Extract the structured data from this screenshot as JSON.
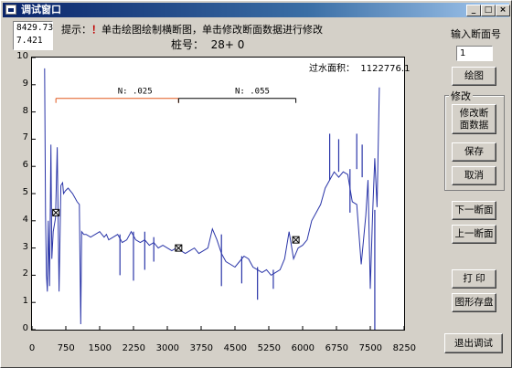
{
  "window": {
    "title": "调试窗口",
    "controls": {
      "minimize": "_",
      "maximize": "□",
      "close": "×"
    }
  },
  "coords": {
    "x": "8429.73",
    "y": "7.421"
  },
  "hint": {
    "prefix": "提示：",
    "mark": "！",
    "text": "单击绘图绘制横断图，单击修改断面数据进行修改"
  },
  "station": {
    "label": "桩号：",
    "value": "28+ 0"
  },
  "area": {
    "label": "过水面积：",
    "value": "1122776.1"
  },
  "roughness": [
    {
      "label": "N: .025",
      "color": "#e0581f"
    },
    {
      "label": "N: .055",
      "color": "#000000"
    }
  ],
  "sidebar": {
    "section_input_label": "输入断面号",
    "section_input_value": "1",
    "draw_button": "绘图",
    "modify_group_title": "修改",
    "modify_button": "修改断面数据",
    "save_button": "保存",
    "cancel_button": "取消",
    "next_button": "下一断面",
    "prev_button": "上一断面",
    "print_button": "打 印",
    "save_image_button": "图形存盘",
    "exit_button": "退出调试"
  },
  "chart_data": {
    "type": "line",
    "title": "",
    "xlabel": "",
    "ylabel": "",
    "xlim": [
      0,
      8250
    ],
    "ylim": [
      0,
      10
    ],
    "x_ticks": [
      "0",
      "750",
      "1500",
      "2250",
      "3000",
      "3750",
      "4500",
      "5250",
      "6000",
      "6750",
      "7500",
      "8250"
    ],
    "y_ticks": [
      "0",
      "1",
      "2",
      "3",
      "4",
      "5",
      "6",
      "7",
      "8",
      "9",
      "10"
    ],
    "grid": false,
    "series": [
      {
        "color": "#2a35a8",
        "x": [
          280,
          300,
          320,
          340,
          360,
          390,
          420,
          440,
          470,
          520,
          560,
          600,
          640,
          680,
          700,
          740,
          800,
          900,
          1000,
          1050,
          1080,
          1100,
          1150,
          1200,
          1300,
          1400,
          1500,
          1600,
          1650,
          1700,
          1800,
          1900,
          2000,
          2100,
          2200,
          2300,
          2400,
          2500,
          2600,
          2700,
          2800,
          2900,
          3000,
          3100,
          3200,
          3300,
          3400,
          3500,
          3600,
          3700,
          3800,
          3900,
          4000,
          4100,
          4200,
          4300,
          4400,
          4500,
          4600,
          4700,
          4800,
          4900,
          5000,
          5100,
          5200,
          5300,
          5400,
          5500,
          5600,
          5700,
          5800,
          5900,
          6000,
          6100,
          6200,
          6300,
          6400,
          6500,
          6600,
          6700,
          6800,
          6900,
          7000,
          7100,
          7200,
          7300,
          7400,
          7450,
          7500,
          7550,
          7600,
          7650,
          7700
        ],
        "y": [
          9.6,
          4.2,
          2.0,
          1.4,
          4.0,
          1.6,
          6.8,
          2.6,
          3.6,
          4.1,
          6.7,
          1.4,
          5.3,
          5.4,
          5.0,
          5.1,
          5.2,
          5.0,
          4.7,
          4.6,
          0.2,
          3.6,
          3.5,
          3.5,
          3.4,
          3.5,
          3.6,
          3.4,
          3.5,
          3.3,
          3.4,
          3.5,
          3.2,
          3.3,
          3.6,
          3.3,
          3.2,
          3.3,
          3.1,
          3.2,
          3.0,
          3.1,
          3.0,
          2.9,
          3.0,
          2.9,
          2.8,
          2.9,
          3.0,
          2.8,
          2.9,
          3.0,
          3.7,
          3.3,
          2.8,
          2.5,
          2.4,
          2.3,
          2.5,
          2.7,
          2.6,
          2.3,
          2.2,
          2.1,
          2.2,
          2.0,
          2.1,
          2.2,
          2.6,
          3.6,
          2.6,
          3.0,
          3.1,
          3.3,
          4.0,
          4.3,
          4.6,
          5.2,
          5.5,
          5.8,
          5.6,
          5.8,
          5.7,
          4.7,
          4.6,
          2.4,
          4.2,
          5.5,
          1.5,
          4.2,
          6.3,
          4.5,
          8.9
        ]
      }
    ],
    "spikes": [
      {
        "x": 1950,
        "y": [
          3.5,
          2.0
        ]
      },
      {
        "x": 2250,
        "y": [
          3.6,
          1.8
        ]
      },
      {
        "x": 2500,
        "y": [
          3.6,
          2.2
        ]
      },
      {
        "x": 2700,
        "y": [
          3.4,
          2.5
        ]
      },
      {
        "x": 4200,
        "y": [
          3.5,
          1.6
        ]
      },
      {
        "x": 4650,
        "y": [
          2.7,
          1.7
        ]
      },
      {
        "x": 5000,
        "y": [
          2.3,
          1.1
        ]
      },
      {
        "x": 5350,
        "y": [
          2.2,
          1.5
        ]
      },
      {
        "x": 6600,
        "y": [
          5.5,
          7.2
        ]
      },
      {
        "x": 6800,
        "y": [
          5.8,
          7.0
        ]
      },
      {
        "x": 7050,
        "y": [
          5.9,
          4.3
        ]
      },
      {
        "x": 7200,
        "y": [
          5.9,
          7.2
        ]
      },
      {
        "x": 7320,
        "y": [
          5.6,
          6.8
        ]
      },
      {
        "x": 7600,
        "y": [
          4.4,
          -0.5
        ]
      }
    ],
    "markers": [
      {
        "x": 530,
        "y": 4.3
      },
      {
        "x": 3250,
        "y": 3.0
      },
      {
        "x": 5850,
        "y": 3.3
      }
    ],
    "roughness_segments": [
      {
        "x_start": 530,
        "x_end": 3250,
        "y": 8.5,
        "label_x": 1900
      },
      {
        "x_start": 3250,
        "x_end": 5850,
        "y": 8.5,
        "label_x": 4500
      }
    ]
  }
}
